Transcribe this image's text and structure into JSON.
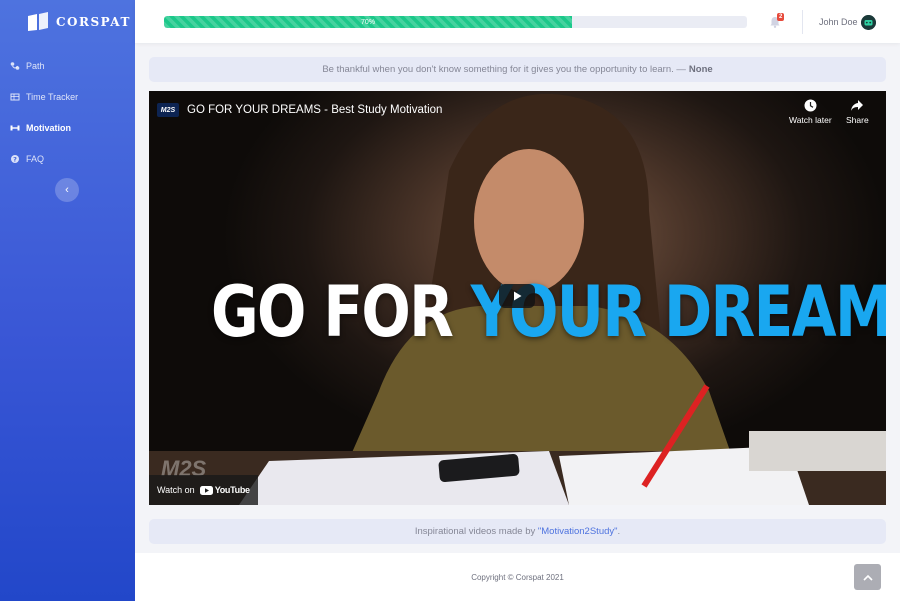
{
  "brand": {
    "name": "CORSPAT"
  },
  "sidebar": {
    "items": [
      {
        "label": "Path",
        "icon": "route-icon",
        "active": false
      },
      {
        "label": "Time Tracker",
        "icon": "table-icon",
        "active": false
      },
      {
        "label": "Motivation",
        "icon": "dumbbell-icon",
        "active": true
      },
      {
        "label": "FAQ",
        "icon": "question-circle-icon",
        "active": false
      }
    ],
    "collapse_symbol": "‹"
  },
  "topbar": {
    "progress": {
      "value": 0.7,
      "label": "70%"
    },
    "notifications": {
      "count": "2",
      "icon": "bell-icon"
    },
    "user": {
      "name": "John Doe",
      "icon": "robot-avatar-icon"
    }
  },
  "quote": {
    "text": "Be thankful when you don't know something for it gives you the opportunity to learn. —",
    "author": "None"
  },
  "video": {
    "channel_logo": "M2S",
    "title": "GO FOR YOUR DREAMS - Best Study Motivation",
    "watch_later": "Watch later",
    "share": "Share",
    "headline_white": "GO FOR",
    "headline_blue": "YOUR DREAMS.",
    "watermark": "M2S",
    "watch_on": "Watch on",
    "youtube": "YouTube"
  },
  "credit": {
    "prefix": "Inspirational videos made by",
    "link": "\"Motivation2Study\"",
    "suffix": "."
  },
  "footer": {
    "copyright": "Copyright © Corspat 2021"
  },
  "colors": {
    "sidebar": "#4e73df",
    "progress": "#1cc88a",
    "badge": "#e74a3b",
    "headline_blue": "#19a7f0"
  }
}
